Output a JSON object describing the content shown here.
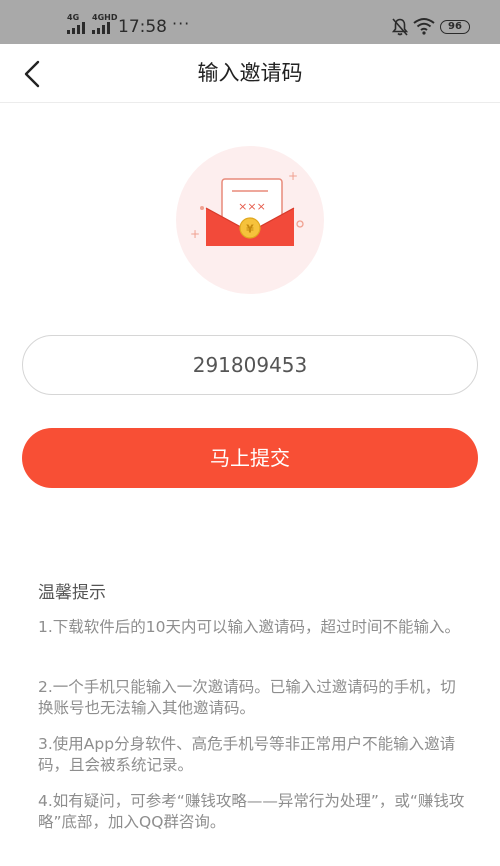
{
  "status_bar": {
    "signal1_label": "4G",
    "signal2_label": "4GHD",
    "time": "17:58",
    "more_dots": "···",
    "battery_level": "96"
  },
  "nav": {
    "title": "输入邀请码",
    "back_icon": "chevron-left-icon"
  },
  "illustration": {
    "icon": "red-envelope-invite-icon",
    "letter_text": "×××",
    "coin_symbol": "¥",
    "colors": {
      "bg_circle": "#fdeeee",
      "envelope": "#f24a3a",
      "coin": "#f6c23c"
    }
  },
  "form": {
    "invite_code_value": "291809453",
    "submit_label": "马上提交"
  },
  "tips": {
    "title": "温馨提示",
    "items": [
      "1.下载软件后的10天内可以输入邀请码，超过时间不能输入。",
      "2.一个手机只能输入一次邀请码。已输入过邀请码的手机，切换账号也无法输入其他邀请码。",
      "3.使用App分身软件、高危手机号等非正常用户不能输入邀请码，且会被系统记录。",
      "4.如有疑问，可参考“赚钱攻略——异常行为处理”，或“赚钱攻略”底部，加入QQ群咨询。"
    ]
  },
  "colors": {
    "accent": "#f84f35",
    "status_bar_bg": "#a9a9a9",
    "tip_text": "#8e8e8e"
  }
}
